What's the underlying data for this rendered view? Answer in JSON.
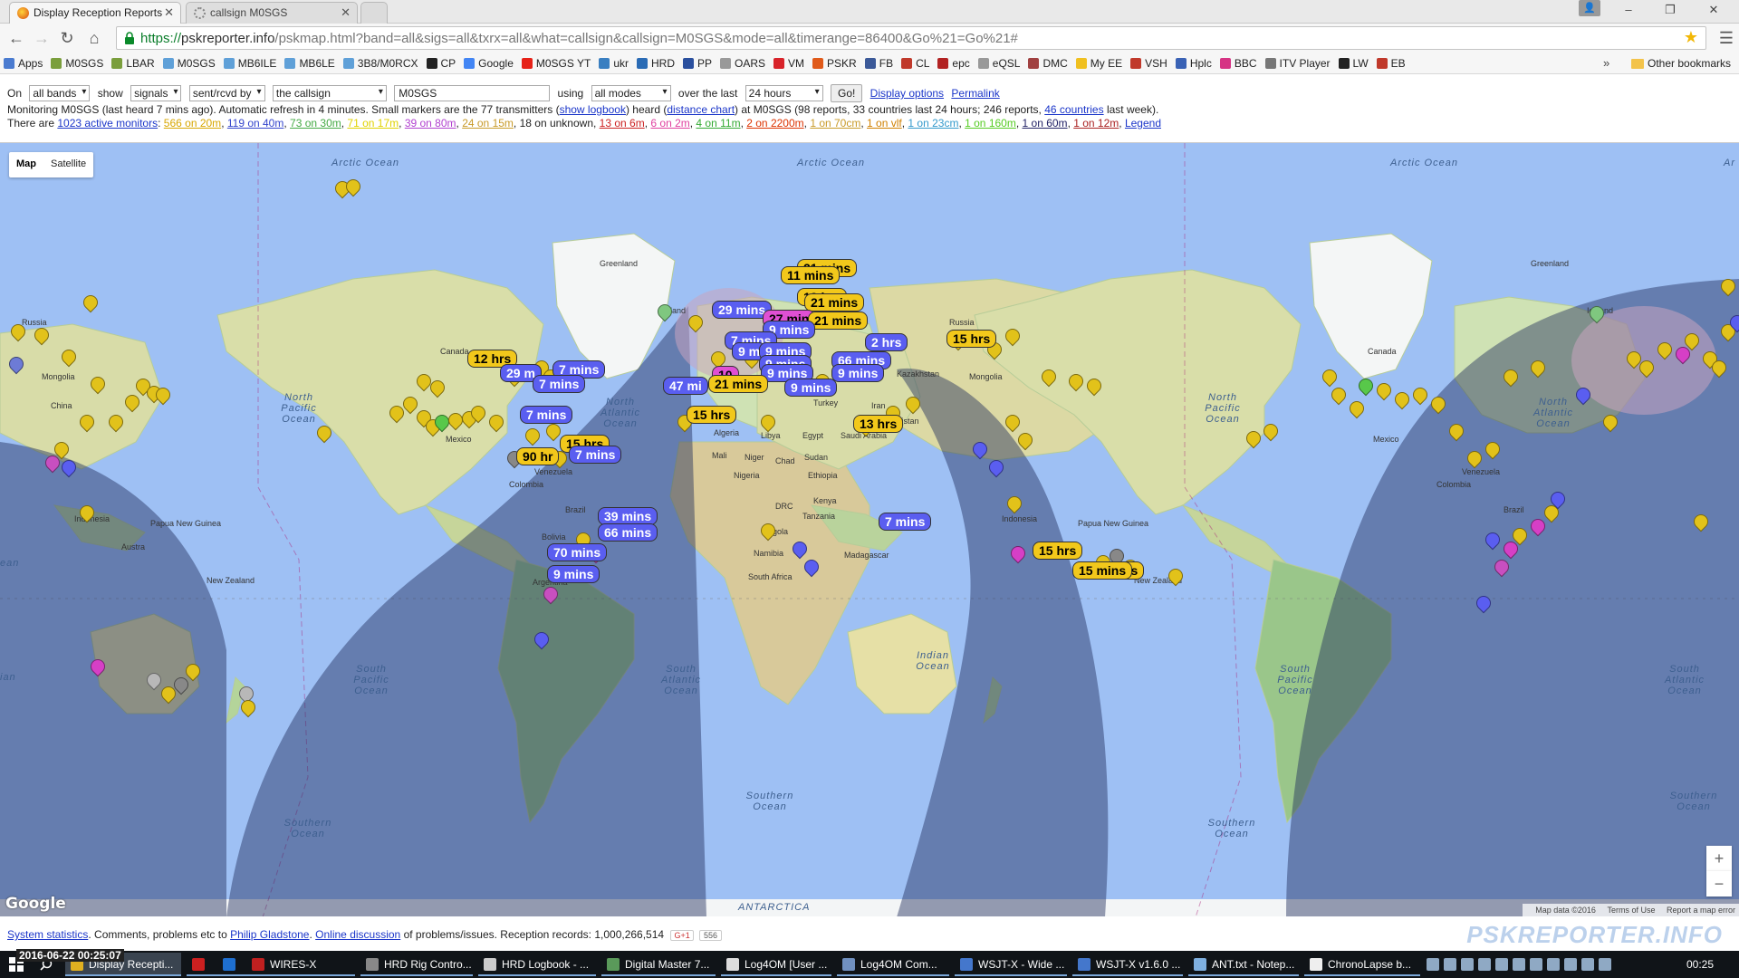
{
  "browser": {
    "tabs": [
      {
        "title": "Display Reception Reports",
        "active": true
      },
      {
        "title": "callsign M0SGS",
        "active": false
      }
    ],
    "url": {
      "scheme": "https://",
      "host": "pskreporter.info",
      "path": "/pskmap.html?band=all&sigs=all&txrx=all&what=callsign&callsign=M0SGS&mode=all&timerange=86400&Go%21=Go%21#"
    },
    "window_controls": {
      "minimize": "–",
      "restore": "❐",
      "close": "✕"
    },
    "bookmarks": [
      {
        "label": "Apps",
        "color": "#4a7bd0"
      },
      {
        "label": "M0SGS",
        "color": "#7a9e3c"
      },
      {
        "label": "LBAR",
        "color": "#7a9e3c"
      },
      {
        "label": "M0SGS",
        "color": "#5fa0d8"
      },
      {
        "label": "MB6ILE",
        "color": "#5fa0d8"
      },
      {
        "label": "MB6LE",
        "color": "#5fa0d8"
      },
      {
        "label": "3B8/M0RCX",
        "color": "#5fa0d8"
      },
      {
        "label": "CP",
        "color": "#222222"
      },
      {
        "label": "Google",
        "color": "#4285f4"
      },
      {
        "label": "M0SGS YT",
        "color": "#e62117"
      },
      {
        "label": "ukr",
        "color": "#3a7fc1"
      },
      {
        "label": "HRD",
        "color": "#2a6bb5"
      },
      {
        "label": "PP",
        "color": "#2a4f9e"
      },
      {
        "label": "OARS",
        "color": "#999999"
      },
      {
        "label": "VM",
        "color": "#d8232a"
      },
      {
        "label": "PSKR",
        "color": "#e05a1a"
      },
      {
        "label": "FB",
        "color": "#3b5998"
      },
      {
        "label": "CL",
        "color": "#c0392b"
      },
      {
        "label": "epc",
        "color": "#b22222"
      },
      {
        "label": "eQSL",
        "color": "#999999"
      },
      {
        "label": "DMC",
        "color": "#a04040"
      },
      {
        "label": "My EE",
        "color": "#f0c020"
      },
      {
        "label": "VSH",
        "color": "#c0392b"
      },
      {
        "label": "Hplc",
        "color": "#3a62b5"
      },
      {
        "label": "BBC",
        "color": "#d63384"
      },
      {
        "label": "ITV Player",
        "color": "#777777"
      },
      {
        "label": "LW",
        "color": "#222222"
      },
      {
        "label": "EB",
        "color": "#c0392b"
      }
    ],
    "bookmarks_more": "»",
    "other_bookmarks": "Other bookmarks"
  },
  "controls": {
    "on_label": "On",
    "band": "all bands",
    "show_label": "show",
    "signals": "signals",
    "direction": "sent/rcvd by",
    "what": "the callsign",
    "callsign": "M0SGS",
    "using_label": "using",
    "mode": "all modes",
    "over_label": "over the last",
    "timerange": "24 hours",
    "go": "Go!",
    "display_options": "Display options",
    "permalink": "Permalink"
  },
  "status": {
    "prefix": "Monitoring M0SGS (last heard 7 mins ago). Automatic refresh in 4 minutes. Small markers are the 77 transmitters (",
    "show_logbook": "show logbook",
    "mid1": ") heard (",
    "distance_chart": "distance chart",
    "mid2": ") at M0SGS (98 reports, 33 countries last 24 hours; 246 reports,",
    "countries": "46 countries",
    "suffix": "last week)."
  },
  "monitors": {
    "prefix": "There are",
    "active": "1023 active monitors",
    "sep": ":",
    "bands": [
      {
        "text": "566 on 20m",
        "color": "#d8a700"
      },
      {
        "text": "119 on 40m",
        "color": "#3344cc"
      },
      {
        "text": "73 on 30m",
        "color": "#44aa44"
      },
      {
        "text": "71 on 17m",
        "color": "#e0d200"
      },
      {
        "text": "39 on 80m",
        "color": "#b140d0"
      },
      {
        "text": "24 on 15m",
        "color": "#c89a28"
      }
    ],
    "unknown": "18 on unknown,",
    "bands2": [
      {
        "text": "13 on 6m",
        "color": "#cc2222"
      },
      {
        "text": "6 on 2m",
        "color": "#e040a0"
      },
      {
        "text": "4 on 11m",
        "color": "#33aa33"
      },
      {
        "text": "2 on 2200m",
        "color": "#dd3300"
      },
      {
        "text": "1 on 70cm",
        "color": "#c89a28"
      },
      {
        "text": "1 on vlf",
        "color": "#d08000"
      },
      {
        "text": "1 on 23cm",
        "color": "#3399cc"
      },
      {
        "text": "1 on 160m",
        "color": "#55cc22"
      },
      {
        "text": "1 on 60m",
        "color": "#222266"
      },
      {
        "text": "1 on 12m",
        "color": "#aa2222"
      }
    ],
    "legend": "Legend"
  },
  "map": {
    "type_map": "Map",
    "type_satellite": "Satellite",
    "oceans": {
      "arctic1": "Arctic Ocean",
      "arctic2": "Arctic Ocean",
      "arctic3": "Ar",
      "npac1": "North Pacific Ocean",
      "natl1": "North Atlantic Ocean",
      "npac2": "North Pacific Ocean",
      "natl2": "North Atlantic Ocean",
      "spac1": "South Pacific Ocean",
      "satl1": "South Atlantic Ocean",
      "indian1": "Indian Ocean",
      "spac2": "South Pacific Ocean",
      "satl2": "South Atlantic Ocean",
      "south1": "Southern Ocean",
      "south2": "Southern Ocean",
      "south3": "Southern Ocean",
      "antarctica": "ANTARCTICA",
      "ean": "ean",
      "ian": "ian"
    },
    "land": {
      "greenland1": "Greenland",
      "greenland2": "Greenland",
      "russia1": "Russia",
      "russia2": "Russia",
      "mongolia1": "Mongolia",
      "mongolia2": "Mongolia",
      "china": "China",
      "canada1": "Canada",
      "canada2": "Canada",
      "mexico1": "Mexico",
      "mexico2": "Mexico",
      "iceland1": "Iceland",
      "iceland2": "Iceland",
      "indonesia1": "Indonesia",
      "indonesia2": "Indonesia",
      "png1": "Papua New Guinea",
      "png2": "Papua New Guinea",
      "australia": "Austra",
      "nz1": "New Zealand",
      "nz2": "New Zealand",
      "brazil1": "Brazil",
      "brazil2": "Brazil",
      "bolivia": "Bolivia",
      "colombia1": "Colombia",
      "colombia2": "Colombia",
      "venezuela1": "Venezuela",
      "venezuela2": "Venezuela",
      "argentina": "Argentina",
      "algeria": "Algeria",
      "libya": "Libya",
      "egypt": "Egypt",
      "mali": "Mali",
      "niger": "Niger",
      "chad": "Chad",
      "sudan": "Sudan",
      "ethiopia": "Ethiopia",
      "kenya": "Kenya",
      "tanzania": "Tanzania",
      "drc": "DRC",
      "angola": "Angola",
      "namibia": "Namibia",
      "southafrica": "South Africa",
      "madagascar": "Madagascar",
      "turkey": "Turkey",
      "iran": "Iran",
      "kazakhstan": "Kazakhstan",
      "pakistan": "Pakistan",
      "saudi": "Saudi Arabia",
      "nigeria": "Nigeria"
    },
    "tags": [
      {
        "t": "21 mins",
        "c": "y"
      },
      {
        "t": "11 mins",
        "c": "y"
      },
      {
        "t": "13 hrs",
        "c": "y"
      },
      {
        "t": "21 mins",
        "c": "y"
      },
      {
        "t": "29 mins",
        "c": "b"
      },
      {
        "t": "27 min",
        "c": "m"
      },
      {
        "t": "21 mins",
        "c": "y"
      },
      {
        "t": "9 mins",
        "c": "b"
      },
      {
        "t": "7 mins",
        "c": "b"
      },
      {
        "t": "2 hrs",
        "c": "b"
      },
      {
        "t": "15 hrs",
        "c": "y"
      },
      {
        "t": "9 m",
        "c": "b"
      },
      {
        "t": "9 mins",
        "c": "b"
      },
      {
        "t": "9 mins",
        "c": "b"
      },
      {
        "t": "66 mins",
        "c": "b"
      },
      {
        "t": "10",
        "c": "m"
      },
      {
        "t": "9 mins",
        "c": "b"
      },
      {
        "t": "9 mins",
        "c": "b"
      },
      {
        "t": "47 mi",
        "c": "b"
      },
      {
        "t": "21 mins",
        "c": "y"
      },
      {
        "t": "9 mins",
        "c": "b"
      },
      {
        "t": "15 hrs",
        "c": "y"
      },
      {
        "t": "13 hrs",
        "c": "y"
      },
      {
        "t": "12 hrs",
        "c": "y"
      },
      {
        "t": "29 m",
        "c": "b"
      },
      {
        "t": "7 mins",
        "c": "b"
      },
      {
        "t": "7 mins",
        "c": "b"
      },
      {
        "t": "7 mins",
        "c": "b"
      },
      {
        "t": "15 hrs",
        "c": "y"
      },
      {
        "t": "90 hr",
        "c": "y"
      },
      {
        "t": "7 mins",
        "c": "b"
      },
      {
        "t": "39 mins",
        "c": "b"
      },
      {
        "t": "66 mins",
        "c": "b"
      },
      {
        "t": "70 mins",
        "c": "b"
      },
      {
        "t": "9 mins",
        "c": "b"
      },
      {
        "t": "7 mins",
        "c": "b"
      },
      {
        "t": "15 hrs",
        "c": "y"
      },
      {
        "t": "13 hrs",
        "c": "y"
      },
      {
        "t": "15 mins",
        "c": "y"
      }
    ],
    "zoom_in": "+",
    "zoom_out": "−",
    "logo": "Google",
    "attribution": {
      "data": "Map data ©2016",
      "terms": "Terms of Use",
      "report": "Report a map error"
    }
  },
  "footer": {
    "system_statistics": "System statistics",
    "comments": ". Comments, problems etc to",
    "philip": "Philip Gladstone",
    "dot": ".",
    "online_discussion": "Online discussion",
    "records": "of problems/issues. Reception records: 1,000,266,514",
    "gplus": "G+1",
    "gcount": "556",
    "brand": "PSKREPORTER.INFO"
  },
  "taskbar": {
    "timestamp": "2016-06-22 00:25:07",
    "items": [
      {
        "label": "Display Recepti...",
        "color": "#e0b020"
      },
      {
        "label": "",
        "color": "#cc2020"
      },
      {
        "label": "",
        "color": "#1e6fd0"
      },
      {
        "label": "WIRES-X",
        "color": "#c02020"
      },
      {
        "label": "HRD Rig Contro...",
        "color": "#888888"
      },
      {
        "label": "HRD Logbook - ...",
        "color": "#cccccc"
      },
      {
        "label": "Digital Master 7...",
        "color": "#5a9a5a"
      },
      {
        "label": "Log4OM [User ...",
        "color": "#ddd"
      },
      {
        "label": "Log4OM Com...",
        "color": "#7090c0"
      },
      {
        "label": "WSJT-X - Wide ...",
        "color": "#4477cc"
      },
      {
        "label": "WSJT-X   v1.6.0 ...",
        "color": "#4477cc"
      },
      {
        "label": "ANT.txt - Notep...",
        "color": "#7fb0e0"
      },
      {
        "label": "ChronoLapse b...",
        "color": "#eeeeee"
      }
    ],
    "clock": "00:25"
  }
}
